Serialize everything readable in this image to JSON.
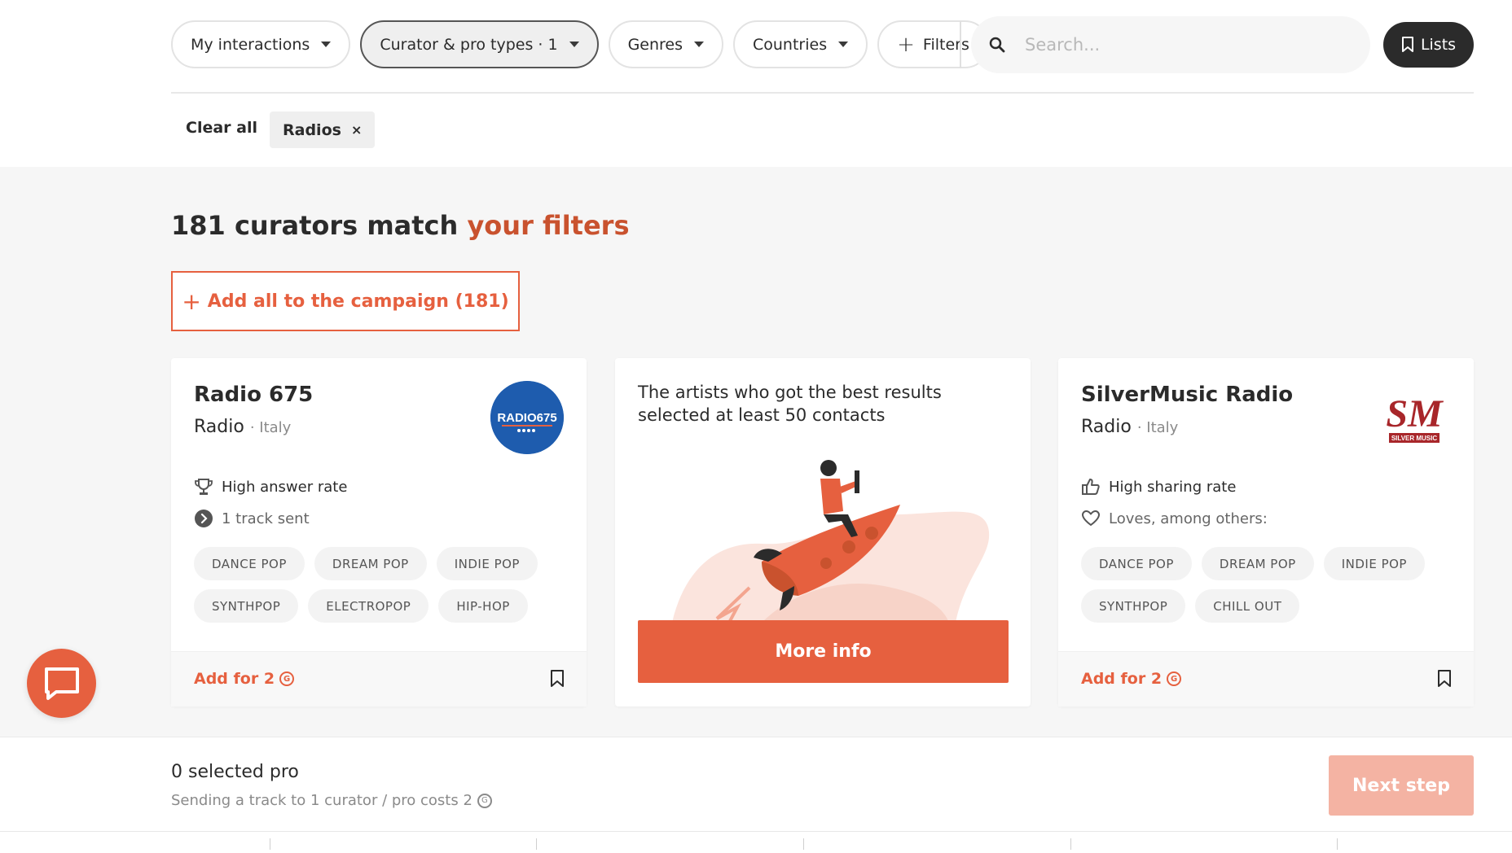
{
  "filters": {
    "my_interactions": "My interactions",
    "curator_types": "Curator & pro types · 1",
    "genres": "Genres",
    "countries": "Countries",
    "more_filters": "Filters"
  },
  "search": {
    "placeholder": "Search..."
  },
  "lists_label": "Lists",
  "active_filters": {
    "clear_all": "Clear all",
    "chips": [
      {
        "label": "Radios",
        "remove": "×"
      }
    ]
  },
  "results": {
    "count_text": "181 curators match ",
    "accent_text": "your filters",
    "add_all_label": "Add all to the campaign (181)",
    "add_all_plus": "+"
  },
  "cards": [
    {
      "name": "Radio 675",
      "type": "Radio",
      "country": "· Italy",
      "logo_text": "RADIO675",
      "stats": [
        "High answer rate",
        "1 track sent"
      ],
      "tags": [
        "DANCE POP",
        "DREAM POP",
        "INDIE POP",
        "SYNTHPOP",
        "ELECTROPOP",
        "HIP-HOP"
      ],
      "add_label": "Add for 2",
      "coin": "G"
    },
    {
      "promo_text": "The artists who got the best results selected at least 50 contacts",
      "more_info": "More info"
    },
    {
      "name": "SilverMusic Radio",
      "type": "Radio",
      "country": "· Italy",
      "logo_text": "SM",
      "logo_sub": "SILVER MUSIC",
      "stats": [
        "High sharing rate",
        "Loves, among others:"
      ],
      "tags": [
        "DANCE POP",
        "DREAM POP",
        "INDIE POP",
        "SYNTHPOP",
        "CHILL OUT"
      ],
      "add_label": "Add for 2",
      "coin": "G"
    }
  ],
  "footer": {
    "selected": "0 selected pro",
    "cost_text": "Sending a track to 1 curator / pro costs 2",
    "coin": "G",
    "next_step": "Next step"
  },
  "colors": {
    "accent": "#e6603f",
    "accent_dark": "#c9522e",
    "dark": "#2b2b2b",
    "disabled_button": "#f4b3a3"
  }
}
